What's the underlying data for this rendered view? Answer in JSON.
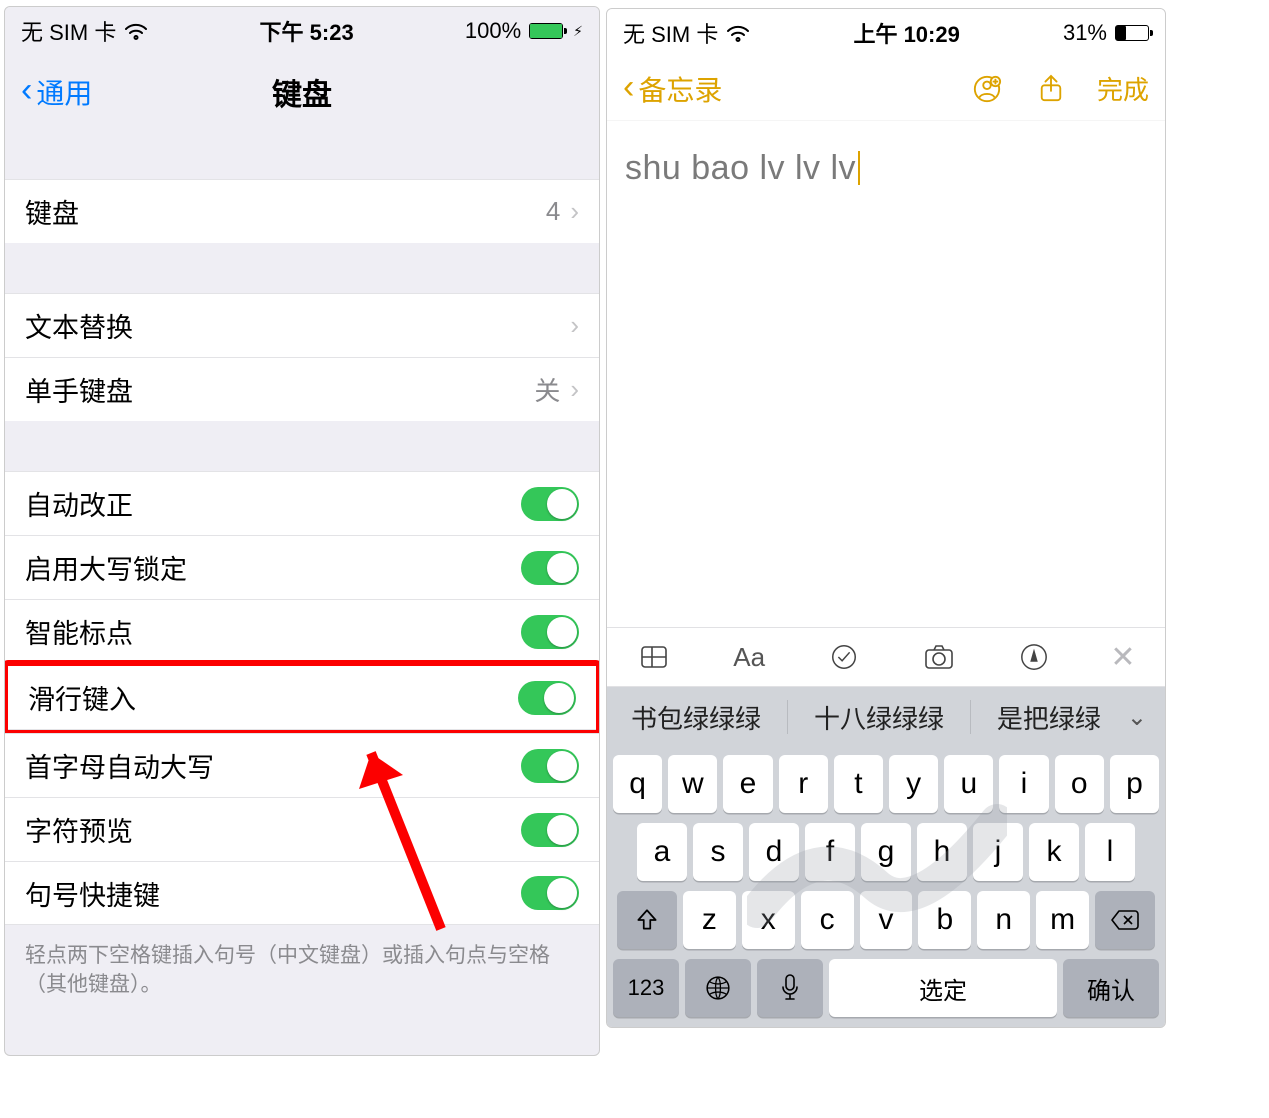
{
  "left": {
    "status": {
      "carrier": "无 SIM 卡",
      "time": "下午 5:23",
      "battery": "100%"
    },
    "nav": {
      "back": "通用",
      "title": "键盘"
    },
    "cells": {
      "keyboards": {
        "label": "键盘",
        "value": "4"
      },
      "textreplace": {
        "label": "文本替换"
      },
      "onehand": {
        "label": "单手键盘",
        "value": "关"
      }
    },
    "toggles": [
      "自动改正",
      "启用大写锁定",
      "智能标点",
      "滑行键入",
      "首字母自动大写",
      "字符预览",
      "句号快捷键"
    ],
    "footer": "轻点两下空格键插入句号（中文键盘）或插入句点与空格（其他键盘）。"
  },
  "right": {
    "status": {
      "carrier": "无 SIM 卡",
      "time": "上午 10:29",
      "battery": "31%"
    },
    "nav": {
      "back": "备忘录",
      "done": "完成"
    },
    "note_text": "shu bao lv lv lv",
    "candidates": [
      "书包绿绿绿",
      "十八绿绿绿",
      "是把绿绿"
    ],
    "keys": {
      "row1": [
        "q",
        "w",
        "e",
        "r",
        "t",
        "y",
        "u",
        "i",
        "o",
        "p"
      ],
      "row2": [
        "a",
        "s",
        "d",
        "f",
        "g",
        "h",
        "j",
        "k",
        "l"
      ],
      "row3": [
        "z",
        "x",
        "c",
        "v",
        "b",
        "n",
        "m"
      ]
    },
    "bottom": {
      "abc": "123",
      "select": "选定",
      "confirm": "确认"
    }
  }
}
